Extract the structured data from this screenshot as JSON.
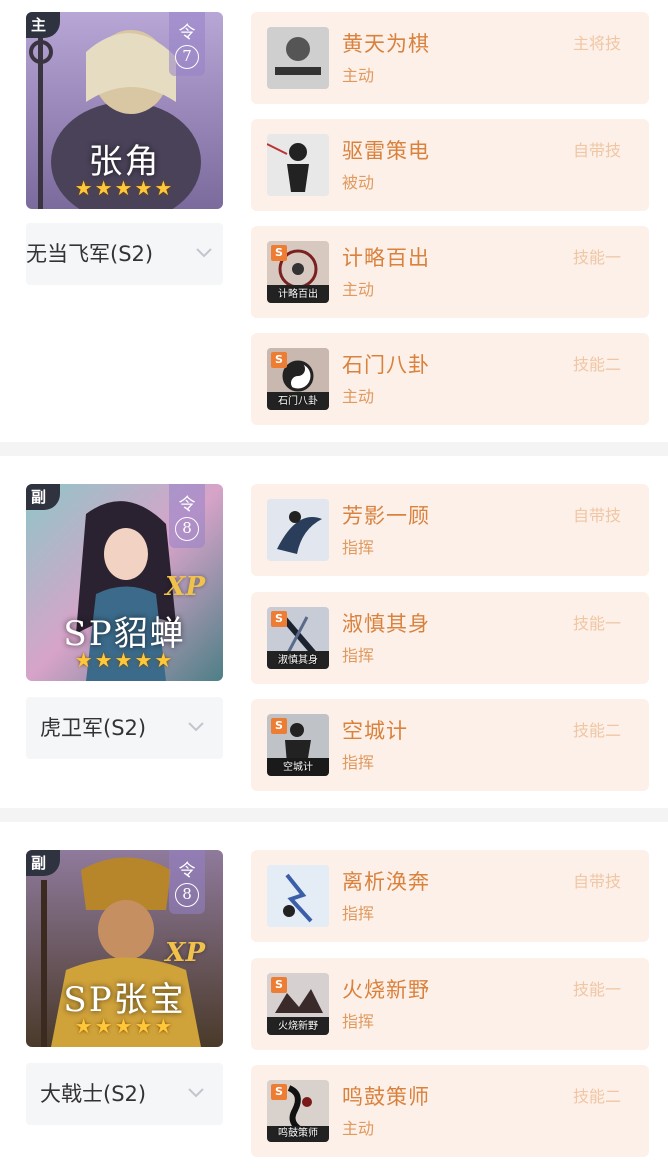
{
  "teams": [
    {
      "role": "主",
      "ling_label": "令",
      "ling_value": "7",
      "hero_name": "张角",
      "xp": "",
      "stars": "★★★★★",
      "army": "无当飞军(S2)",
      "skills": [
        {
          "name": "黄天为棋",
          "type": "主动",
          "slot": "主将技",
          "season": false,
          "icon_text": ""
        },
        {
          "name": "驱雷策电",
          "type": "被动",
          "slot": "自带技",
          "season": false,
          "icon_text": ""
        },
        {
          "name": "计略百出",
          "type": "主动",
          "slot": "技能一",
          "season": true,
          "icon_text": "计略百出"
        },
        {
          "name": "石门八卦",
          "type": "主动",
          "slot": "技能二",
          "season": true,
          "icon_text": "石门八卦"
        }
      ]
    },
    {
      "role": "副",
      "ling_label": "令",
      "ling_value": "8",
      "hero_name": "SP貂蝉",
      "xp": "XP",
      "stars": "★★★★★",
      "army": "虎卫军(S2)",
      "skills": [
        {
          "name": "芳影一顾",
          "type": "指挥",
          "slot": "自带技",
          "season": false,
          "icon_text": ""
        },
        {
          "name": "淑慎其身",
          "type": "指挥",
          "slot": "技能一",
          "season": true,
          "icon_text": "淑慎其身"
        },
        {
          "name": "空城计",
          "type": "指挥",
          "slot": "技能二",
          "season": true,
          "icon_text": "空城计"
        }
      ]
    },
    {
      "role": "副",
      "ling_label": "令",
      "ling_value": "8",
      "hero_name": "SP张宝",
      "xp": "XP",
      "stars": "★★★★★",
      "army": "大戟士(S2)",
      "skills": [
        {
          "name": "离析涣奔",
          "type": "指挥",
          "slot": "自带技",
          "season": false,
          "icon_text": ""
        },
        {
          "name": "火烧新野",
          "type": "指挥",
          "slot": "技能一",
          "season": true,
          "icon_text": "火烧新野"
        },
        {
          "name": "鸣鼓策师",
          "type": "主动",
          "slot": "技能二",
          "season": true,
          "icon_text": "鸣鼓策师"
        }
      ]
    }
  ],
  "colors": {
    "card_bg": "#fdf0e8",
    "skill_name": "#d9823e",
    "skill_slot": "#f0c6a4",
    "season_badge": "#ee7d34",
    "star": "#ffc83a"
  }
}
